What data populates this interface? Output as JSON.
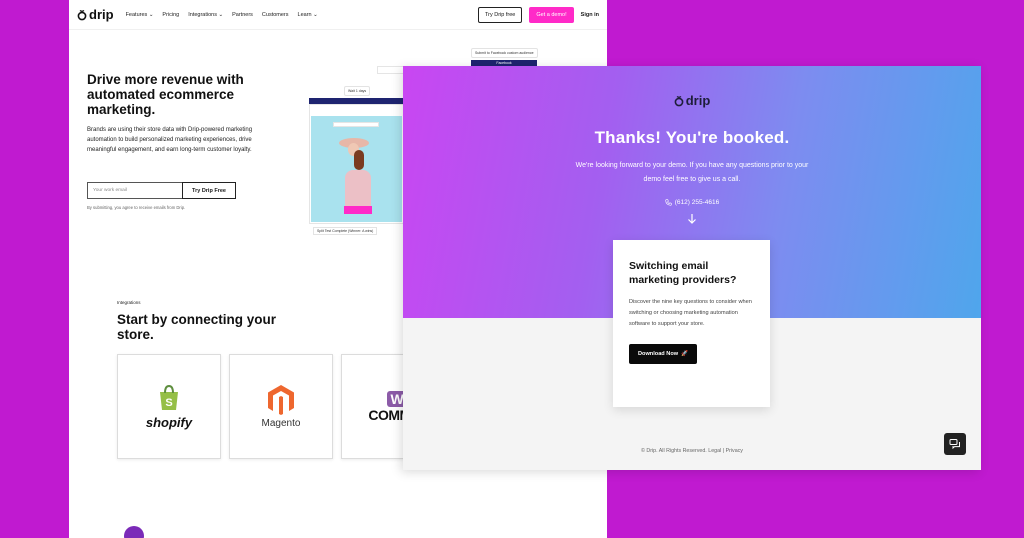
{
  "brand": {
    "name": "drip"
  },
  "nav": {
    "links": [
      "Features",
      "Pricing",
      "Integrations",
      "Partners",
      "Customers",
      "Learn"
    ],
    "try_free": "Try Drip free",
    "get_demo": "Get a demo!",
    "sign_in": "Sign in"
  },
  "hero": {
    "title": "Drive more revenue with automated ecommerce marketing.",
    "description": "Brands are using their store data with Drip-powered marketing automation to build personalized marketing experiences, drive meaningful engagement, and earn long-term customer loyalty.",
    "email_placeholder": "Your work email",
    "cta": "Try Drip Free",
    "disclaimer": "By submitting, you agree to receive emails from Drip."
  },
  "collage": {
    "pill_top": "Submit to Facebook custom audience",
    "bar_label": "Facebook",
    "pill_wait": "Wait 1 days",
    "check_label": "Split Test Complete (Winner: A wins)"
  },
  "integrations": {
    "label": "Integrations",
    "title": "Start by connecting your store.",
    "cards": [
      "shopify",
      "Magento",
      "WOO",
      "COMMERCE"
    ]
  },
  "thanks": {
    "brand": "drip",
    "title": "Thanks! You're booked.",
    "subtitle": "We're looking forward to your demo. If you have any questions prior to your demo feel free to give us a call.",
    "phone": "(612) 255-4616",
    "card": {
      "title": "Switching email marketing providers?",
      "text": "Discover the nine key questions to consider when switching or choosing marketing automation software to support your store.",
      "button": "Download Now"
    },
    "footer_copyright": "© Drip. All Rights Reserved.",
    "footer_legal": "Legal",
    "footer_sep": "|",
    "footer_privacy": "Privacy"
  },
  "colors": {
    "background": "#c01ad0",
    "pink_accent": "#ff2ac8",
    "gradient_start": "#c946f2",
    "gradient_end": "#4fa6ec"
  },
  "icons": [
    "drip-logo-icon",
    "chevron-down-icon",
    "phone-icon",
    "arrow-down-icon",
    "chat-icon",
    "shopify-bag-icon",
    "magento-icon",
    "rocket-icon"
  ]
}
